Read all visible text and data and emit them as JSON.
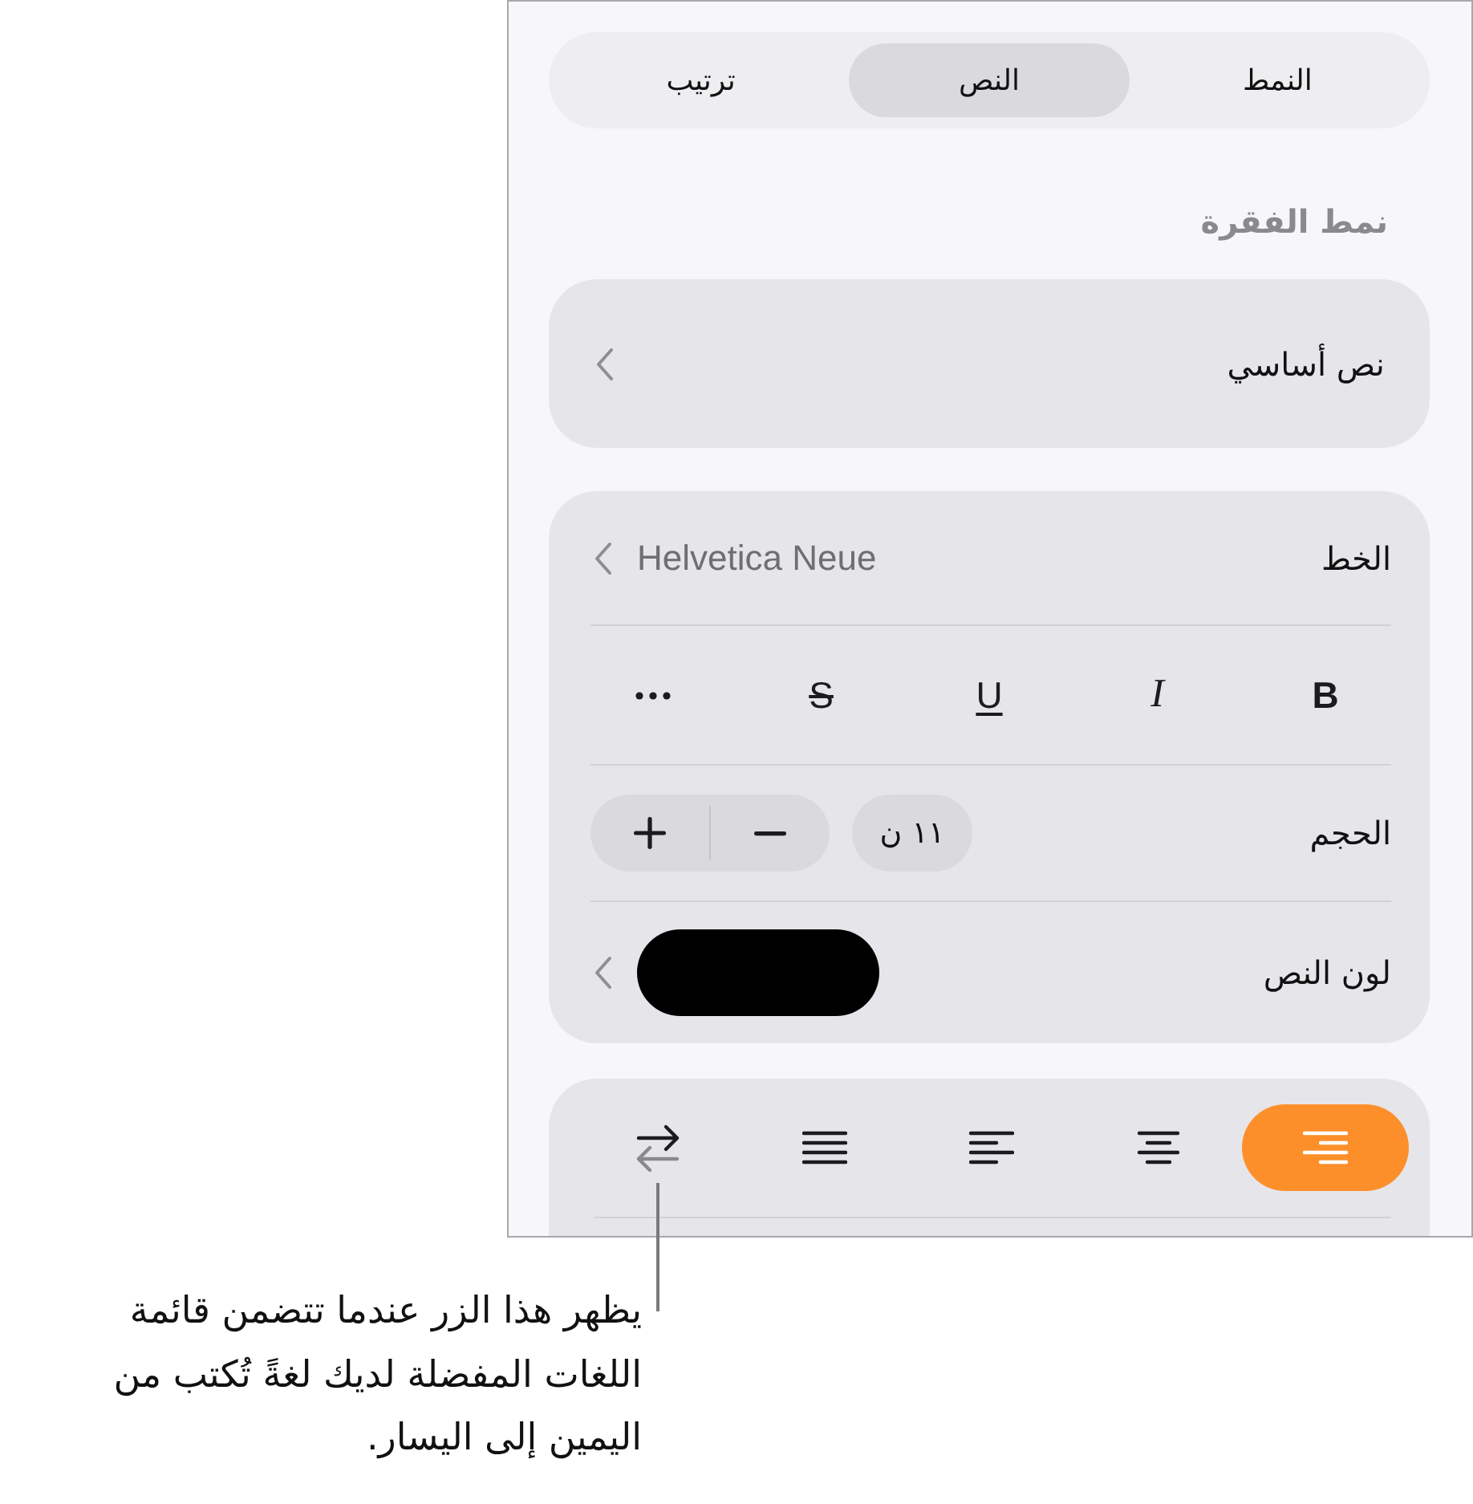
{
  "tabs": [
    {
      "label": "النمط",
      "selected": false
    },
    {
      "label": "النص",
      "selected": true
    },
    {
      "label": "ترتيب",
      "selected": false
    }
  ],
  "paragraph_style": {
    "heading": "نمط الفقرة",
    "value": "نص أساسي"
  },
  "font": {
    "label": "الخط",
    "value": "Helvetica Neue",
    "styles": [
      {
        "kind": "bold",
        "label": "B",
        "on": false
      },
      {
        "kind": "italic",
        "label": "I",
        "on": false
      },
      {
        "kind": "underline",
        "label": "U",
        "on": false
      },
      {
        "kind": "strikethrough",
        "label": "S",
        "on": false
      }
    ]
  },
  "size": {
    "label": "الحجم",
    "value": "١١ ن"
  },
  "text_color": {
    "label": "لون النص",
    "color": "#000000"
  },
  "alignment": [
    {
      "kind": "right",
      "selected": true
    },
    {
      "kind": "center",
      "selected": false
    },
    {
      "kind": "left",
      "selected": false
    },
    {
      "kind": "justify",
      "selected": false
    },
    {
      "kind": "direction",
      "selected": false
    }
  ],
  "callout": {
    "text": "يظهر هذا الزر عندما تتضمن قائمة اللغات المفضلة لديك لغةً تُكتب من اليمين إلى اليسار."
  }
}
